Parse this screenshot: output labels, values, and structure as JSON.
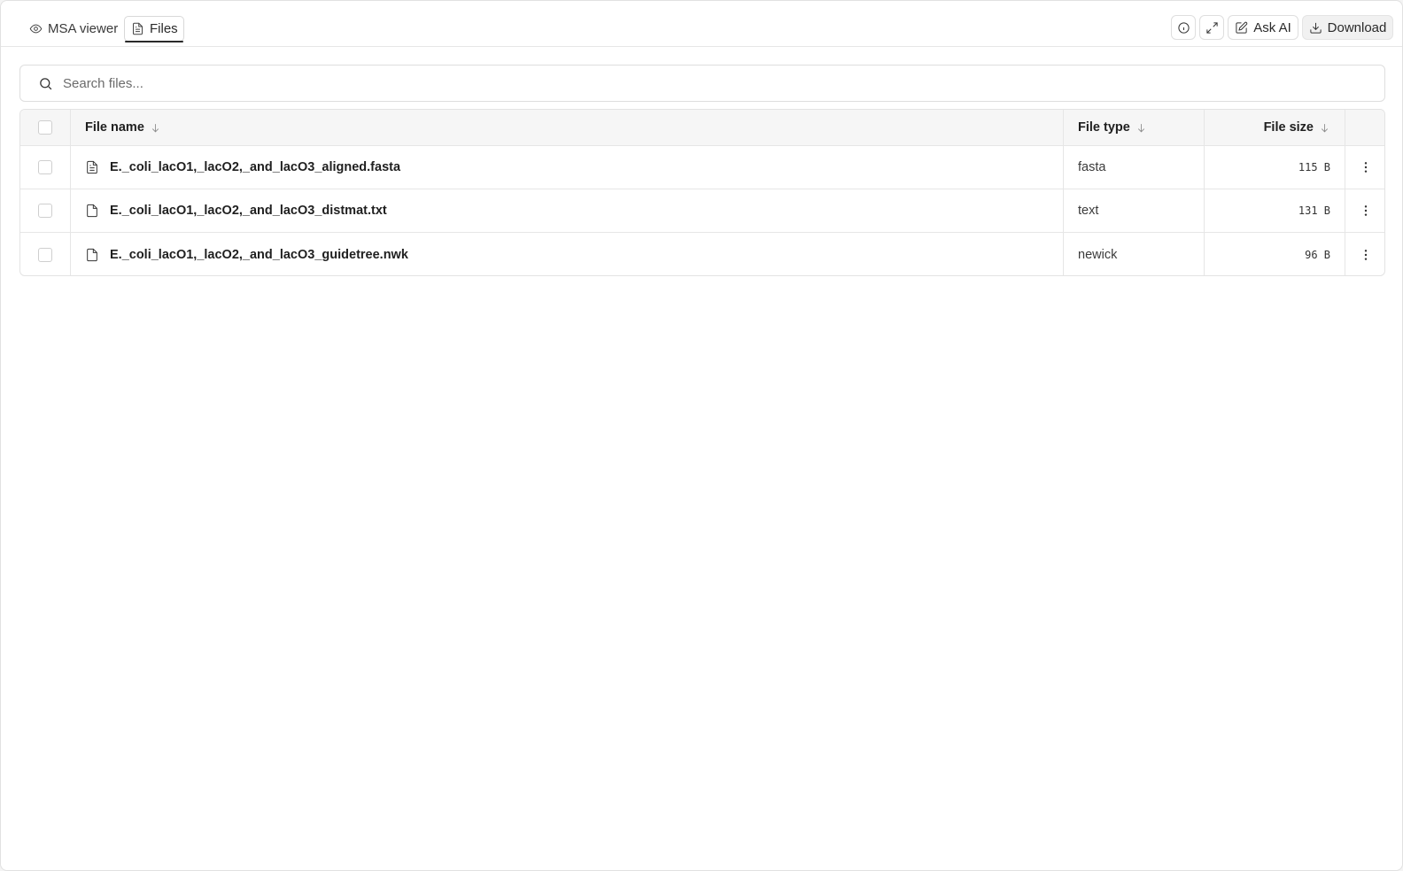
{
  "tabs": [
    {
      "label": "MSA viewer",
      "icon": "eye-icon",
      "active": false
    },
    {
      "label": "Files",
      "icon": "file-icon",
      "active": true
    }
  ],
  "toolbar": {
    "info_icon": "info-icon",
    "expand_icon": "expand-icon",
    "ask_ai_label": "Ask AI",
    "download_label": "Download"
  },
  "search": {
    "placeholder": "Search files...",
    "value": ""
  },
  "table": {
    "columns": {
      "name": "File name",
      "type": "File type",
      "size": "File size"
    },
    "rows": [
      {
        "name": "E._coli_lacO1,_lacO2,_and_lacO3_aligned.fasta",
        "type": "fasta",
        "size": "115 B",
        "icon": "file-text-icon"
      },
      {
        "name": "E._coli_lacO1,_lacO2,_and_lacO3_distmat.txt",
        "type": "text",
        "size": "131 B",
        "icon": "file-icon"
      },
      {
        "name": "E._coli_lacO1,_lacO2,_and_lacO3_guidetree.nwk",
        "type": "newick",
        "size": "96 B",
        "icon": "file-icon"
      }
    ]
  }
}
